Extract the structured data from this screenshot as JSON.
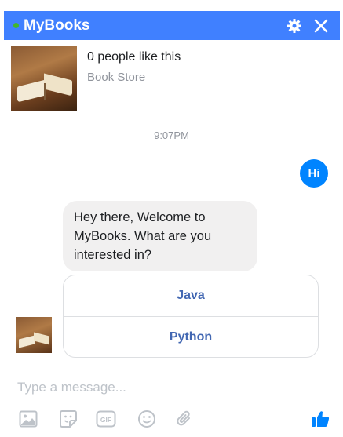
{
  "header": {
    "title": "MyBooks",
    "status_color": "#42b72a",
    "accent_color": "#4080ff",
    "settings_icon": "gear-icon",
    "close_icon": "close-icon"
  },
  "page_info": {
    "likes": "0 people like this",
    "category": "Book Store"
  },
  "conversation": {
    "timestamp": "9:07PM",
    "sent_message": "Hi",
    "received_message": "Hey there, Welcome to MyBooks. What are you interested in?",
    "quick_replies": [
      {
        "label": "Java"
      },
      {
        "label": "Python"
      }
    ]
  },
  "composer": {
    "placeholder": "Type a message..."
  },
  "toolbar": {
    "icons": [
      "image-icon",
      "sticker-icon",
      "gif-icon",
      "emoji-icon",
      "attachment-icon",
      "thumbs-up-icon"
    ]
  }
}
